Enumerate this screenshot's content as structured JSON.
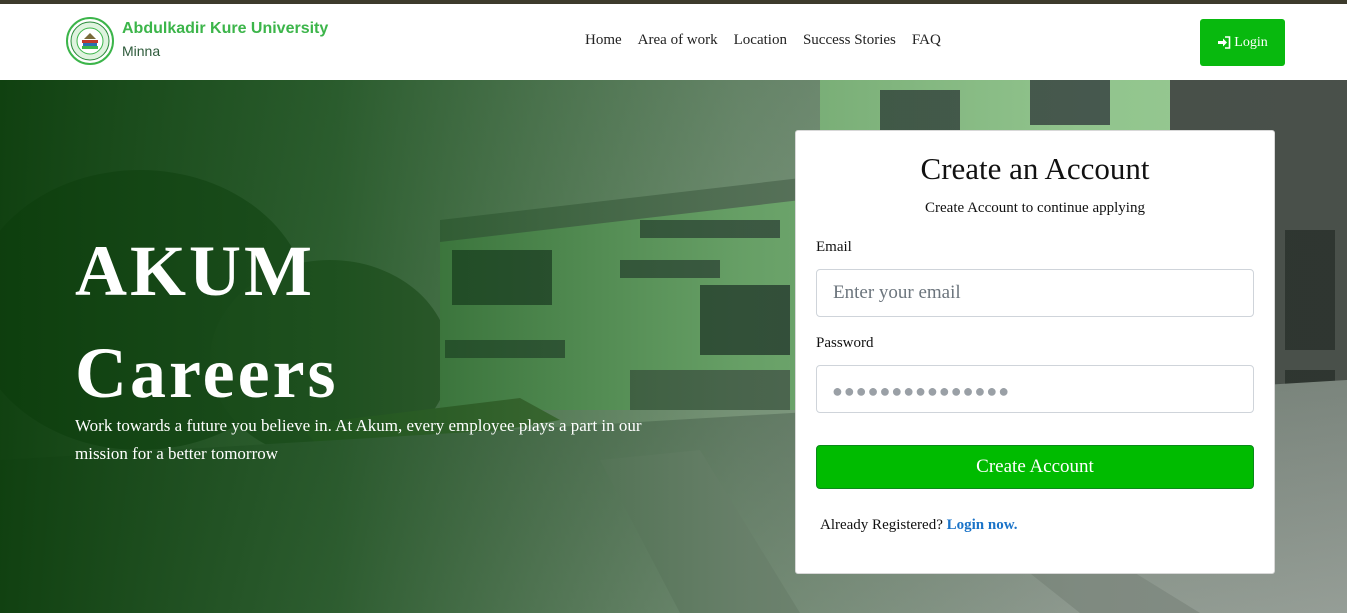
{
  "brand": {
    "name": "Abdulkadir Kure University",
    "city": "Minna"
  },
  "nav": [
    "Home",
    "Area of work",
    "Location",
    "Success Stories",
    "FAQ"
  ],
  "login_label": "Login",
  "hero": {
    "title_line1": "AKUM",
    "title_line2": "Careers",
    "subtitle": "Work towards a future you believe in. At Akum, every employee plays a part in our mission for a better tomorrow"
  },
  "form": {
    "title": "Create an Account",
    "subtitle": "Create Account to continue applying",
    "email_label": "Email",
    "email_placeholder": "Enter your email",
    "password_label": "Password",
    "password_mask": "●●●●●●●●●●●●●●●",
    "submit_label": "Create Account",
    "already_text": "Already Registered?",
    "login_link": "Login now."
  },
  "colors": {
    "brand_green": "#3cb54a",
    "button_green": "#00bb00",
    "link_blue": "#1a73c8",
    "hero_green": "#0f4a12"
  },
  "icons": {
    "login": "sign-in-icon",
    "logo": "university-seal-icon"
  }
}
